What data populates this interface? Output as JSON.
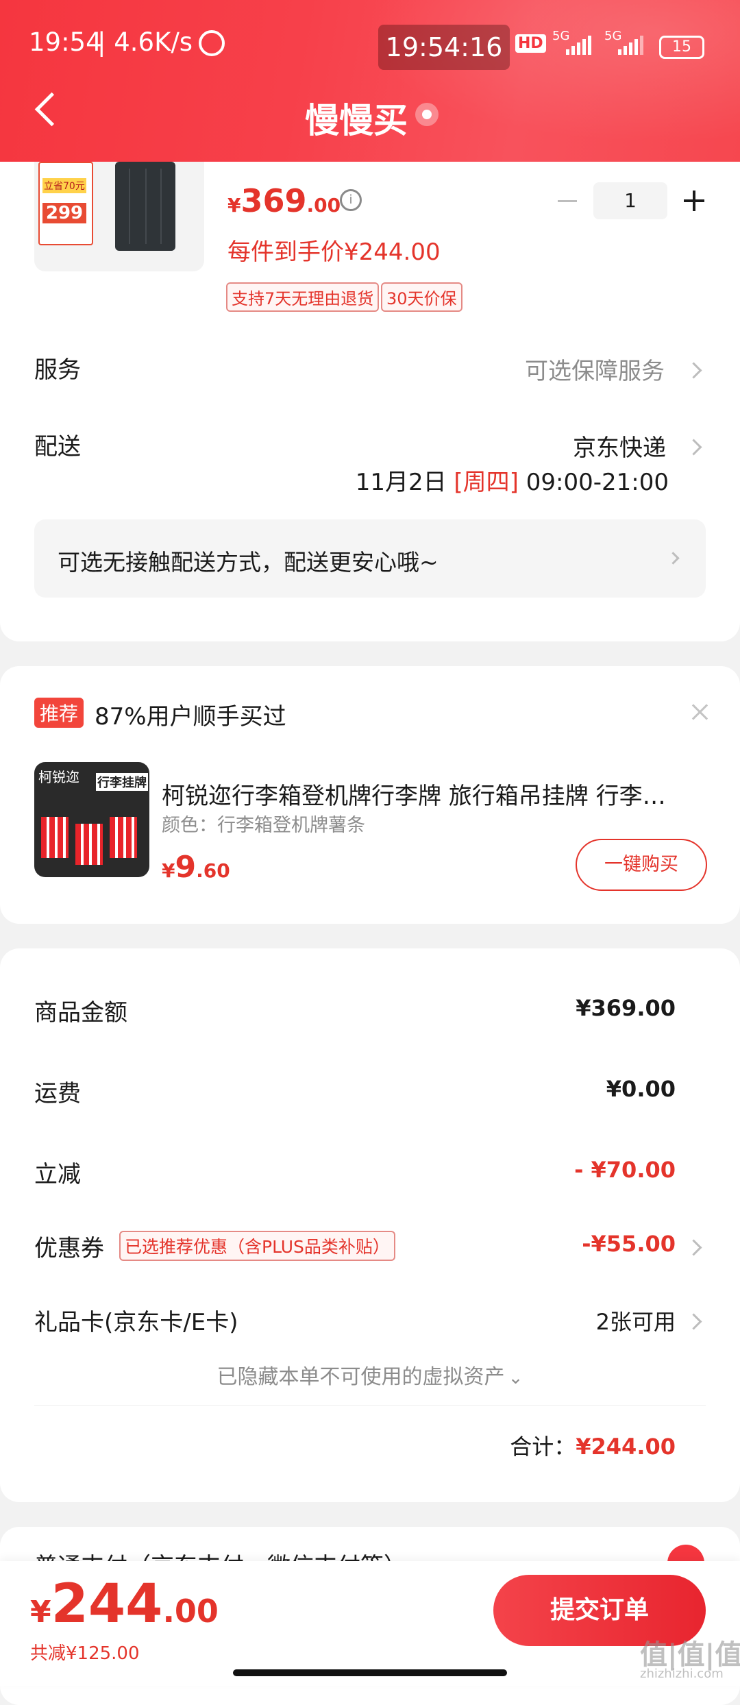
{
  "status_bar": {
    "time": "19:54",
    "net_speed": "| 4.6K/s",
    "clock": "19:54:16",
    "hd": "HD",
    "sim1": "5G",
    "sim2": "5G",
    "battery": "15"
  },
  "header": {
    "title": "慢慢买"
  },
  "product": {
    "thumb_badge1": "立省70元",
    "thumb_badge2": "299",
    "price_symbol": "¥",
    "price_int": "369",
    "price_dec": ".00",
    "unit_price": "每件到手价¥244.00",
    "quantity": "1",
    "tags": [
      "支持7天无理由退货",
      "30天价保"
    ]
  },
  "service": {
    "label": "服务",
    "value": "可选保障服务"
  },
  "delivery": {
    "label": "配送",
    "carrier": "京东快递",
    "date": "11月2日",
    "weekday": "[周四]",
    "time_range": "09:00-21:00",
    "contactless": "可选无接触配送方式，配送更安心哦~"
  },
  "recommend": {
    "badge": "推荐",
    "headline": "87%用户顺手买过",
    "thumb_brand": "柯锐迩",
    "thumb_text": "行李挂牌",
    "item_title": "柯锐迩行李箱登机牌行李牌 旅行箱吊挂牌 行李…",
    "item_spec": "颜色：行李箱登机牌薯条",
    "price_symbol": "¥",
    "price_int": "9",
    "price_dec": ".60",
    "buy_button": "一键购买"
  },
  "summary": {
    "rows": [
      {
        "label": "商品金额",
        "value": "¥369.00"
      },
      {
        "label": "运费",
        "value": "¥0.00"
      },
      {
        "label": "立减",
        "value": "- ¥70.00"
      },
      {
        "label": "优惠券",
        "tag": "已选推荐优惠（含PLUS品类补贴）",
        "value": "-¥55.00"
      },
      {
        "label": "礼品卡(京东卡/E卡)",
        "value": "2张可用"
      }
    ],
    "hidden_note": "已隐藏本单不可使用的虚拟资产",
    "total_label": "合计：",
    "total_value": "¥244.00"
  },
  "payment": {
    "label": "普通支付（京东支付、微信支付等）"
  },
  "bottom_bar": {
    "price_symbol": "¥",
    "price_int": "244",
    "price_dec": ".00",
    "saved": "共减¥125.00",
    "submit": "提交订单"
  },
  "watermark": "值|值|值",
  "watermark_url": "zhizhizhi.com",
  "colors": {
    "brand_red": "#f5363f",
    "price_red": "#e4342b"
  }
}
